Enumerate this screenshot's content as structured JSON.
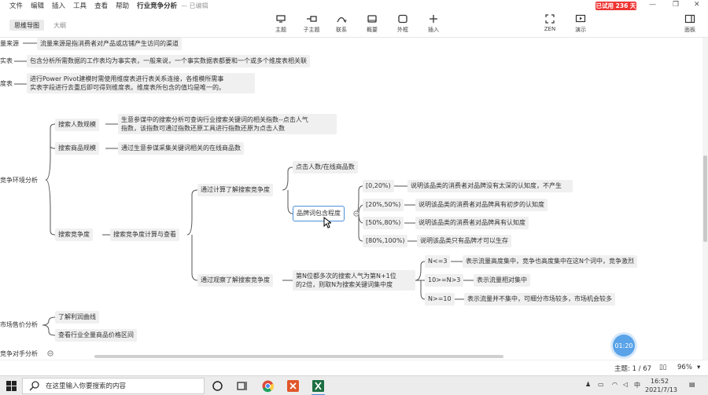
{
  "menu": {
    "items": [
      "文件",
      "编辑",
      "插入",
      "工具",
      "查看",
      "帮助"
    ],
    "doc_title": "行业竞争分析",
    "saved_status": "— 已编辑",
    "trial_badge": "已试用 236 天"
  },
  "toolbar": {
    "tabs": [
      "思维导图",
      "大纲"
    ],
    "tools": [
      {
        "label": "主题",
        "icon": "topic-icon"
      },
      {
        "label": "子主题",
        "icon": "subtopic-icon"
      },
      {
        "label": "联系",
        "icon": "relationship-icon"
      },
      {
        "label": "概要",
        "icon": "summary-icon"
      },
      {
        "label": "外框",
        "icon": "boundary-icon"
      },
      {
        "label": "插入",
        "icon": "plus-icon"
      }
    ],
    "right_tools": [
      {
        "label": "ZEN",
        "icon": "zen-icon"
      },
      {
        "label": "演示",
        "icon": "present-icon"
      },
      {
        "label": "面板",
        "icon": "panel-icon"
      }
    ]
  },
  "mindmap": {
    "top_notes": [
      {
        "head": "量来源",
        "text": "流量来源是指消费者对产品或店铺产生访问的渠道"
      },
      {
        "head": "实表",
        "text": "包含分析所需数据的工作表均为事实表，一般来说，一个事实数据表都要和一个或多个维度表相关联"
      },
      {
        "head": "度表",
        "text_lines": [
          "进行Power Pivot建模时需使用维度表进行表关系连接，各维模所需事",
          "实表字段进行去重后即可得到维度表。维度表所包含的值均是唯一的。"
        ]
      }
    ],
    "root_left": "竞争环境分析",
    "branch_search_size": "搜索人数规模",
    "note_search_size": [
      "生意参谋中的搜索分析可查询行业搜索关键词的相关指数--点击人气",
      "指数，该指数可通过指数还原工具进行指数还原为点击人数"
    ],
    "branch_search_goods": "搜索商品规模",
    "note_search_goods": "通过生意参谋采集关键词相关的在线商品数",
    "branch_competition": "搜索竞争度",
    "node_calc": "搜索竞争度计算与查看",
    "node_via_calc": "通过计算了解搜索竞争度",
    "node_click_ratio": "点击人数/在线商品数",
    "node_selected": "品牌词包含程度",
    "ranges": [
      {
        "range": "[0,20%)",
        "desc": "说明该品类的消费者对品牌没有太深的认知度，不产生"
      },
      {
        "range": "[20%,50%)",
        "desc": "说明该品类的消费者对品牌具有初步的认知度"
      },
      {
        "range": "[50%,80%)",
        "desc": "说明该品类的消费者对品牌具有认知度"
      },
      {
        "range": "[80%,100%)",
        "desc": "说明该品类只有品牌才可以生存"
      }
    ],
    "node_via_observe": "通过观察了解搜索竞争度",
    "node_observe_note": [
      "第N位都多次的搜索人气为第N+1位",
      "的2倍，则取N为搜索关键词集中度"
    ],
    "n_levels": [
      {
        "cond": "N<=3",
        "desc": "表示流量高度集中，竞争也高度集中在这N个词中，竞争激烈"
      },
      {
        "cond": "10>=N>3",
        "desc": "表示流量相对集中"
      },
      {
        "cond": "N>=10",
        "desc": "表示流量并不集中，可细分市场较多，市场机会较多"
      }
    ],
    "root_price": "市场售价分析",
    "price_children": [
      "了解利润曲线",
      "查看行业全量商品价格区间"
    ],
    "root_partial": "竞争对手分析"
  },
  "timer": "01:20",
  "status": {
    "topic_count": "主题: 1 / 67",
    "zoom": "96%"
  },
  "taskbar": {
    "search_placeholder": "在这里输入你要搜索的内容",
    "time": "16:52",
    "date": "2021/7/13",
    "ime": "中"
  },
  "colors": {
    "trial_red": "#e33333",
    "selection_blue": "#4a90d9",
    "timer_blue": "#5aa3e8",
    "excel_green": "#1d6f42",
    "wps_orange": "#e0562b"
  }
}
